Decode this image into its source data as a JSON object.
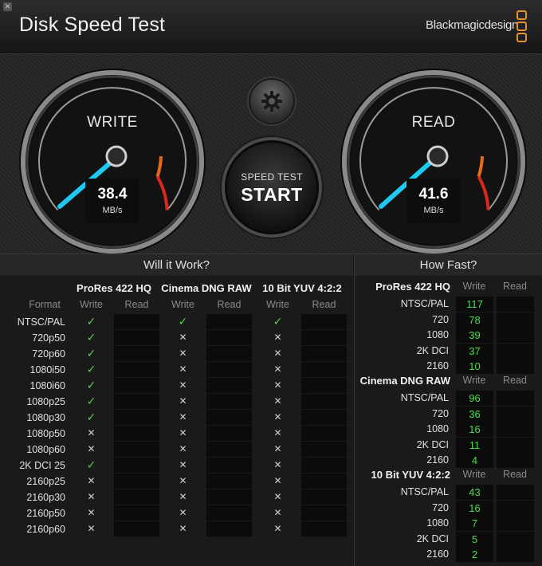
{
  "window": {
    "title": "Disk Speed Test",
    "brand": "Blackmagicdesign"
  },
  "gauges": {
    "write": {
      "label": "WRITE",
      "value": "38.4",
      "unit": "MB/s"
    },
    "read": {
      "label": "READ",
      "value": "41.6",
      "unit": "MB/s"
    }
  },
  "start_button": {
    "small": "SPEED TEST",
    "big": "START"
  },
  "will_it_work": {
    "heading": "Will it Work?",
    "format_label": "Format",
    "codecs": [
      "ProRes 422 HQ",
      "Cinema DNG RAW",
      "10 Bit YUV 4:2:2"
    ],
    "write_label": "Write",
    "read_label": "Read",
    "rows": [
      {
        "format": "NTSC/PAL",
        "w": [
          "✓",
          "✓",
          "✓"
        ]
      },
      {
        "format": "720p50",
        "w": [
          "✓",
          "✕",
          "✕"
        ]
      },
      {
        "format": "720p60",
        "w": [
          "✓",
          "✕",
          "✕"
        ]
      },
      {
        "format": "1080i50",
        "w": [
          "✓",
          "✕",
          "✕"
        ]
      },
      {
        "format": "1080i60",
        "w": [
          "✓",
          "✕",
          "✕"
        ]
      },
      {
        "format": "1080p25",
        "w": [
          "✓",
          "✕",
          "✕"
        ]
      },
      {
        "format": "1080p30",
        "w": [
          "✓",
          "✕",
          "✕"
        ]
      },
      {
        "format": "1080p50",
        "w": [
          "✕",
          "✕",
          "✕"
        ]
      },
      {
        "format": "1080p60",
        "w": [
          "✕",
          "✕",
          "✕"
        ]
      },
      {
        "format": "2K DCI 25",
        "w": [
          "✓",
          "✕",
          "✕"
        ]
      },
      {
        "format": "2160p25",
        "w": [
          "✕",
          "✕",
          "✕"
        ]
      },
      {
        "format": "2160p30",
        "w": [
          "✕",
          "✕",
          "✕"
        ]
      },
      {
        "format": "2160p50",
        "w": [
          "✕",
          "✕",
          "✕"
        ]
      },
      {
        "format": "2160p60",
        "w": [
          "✕",
          "✕",
          "✕"
        ]
      }
    ]
  },
  "how_fast": {
    "heading": "How Fast?",
    "write_label": "Write",
    "read_label": "Read",
    "groups": [
      {
        "name": "ProRes 422 HQ",
        "rows": [
          {
            "label": "NTSC/PAL",
            "write": "117"
          },
          {
            "label": "720",
            "write": "78"
          },
          {
            "label": "1080",
            "write": "39"
          },
          {
            "label": "2K DCI",
            "write": "37"
          },
          {
            "label": "2160",
            "write": "10"
          }
        ]
      },
      {
        "name": "Cinema DNG RAW",
        "rows": [
          {
            "label": "NTSC/PAL",
            "write": "96"
          },
          {
            "label": "720",
            "write": "36"
          },
          {
            "label": "1080",
            "write": "16"
          },
          {
            "label": "2K DCI",
            "write": "11"
          },
          {
            "label": "2160",
            "write": "4"
          }
        ]
      },
      {
        "name": "10 Bit YUV 4:2:2",
        "rows": [
          {
            "label": "NTSC/PAL",
            "write": "43"
          },
          {
            "label": "720",
            "write": "16"
          },
          {
            "label": "1080",
            "write": "7"
          },
          {
            "label": "2K DCI",
            "write": "5"
          },
          {
            "label": "2160",
            "write": "2"
          }
        ]
      }
    ]
  },
  "colors": {
    "needle": "#1ec8f0",
    "check": "#4cd24c",
    "value": "#44e044",
    "brand_accent": "#e8912a",
    "redline": "#d8281c"
  }
}
